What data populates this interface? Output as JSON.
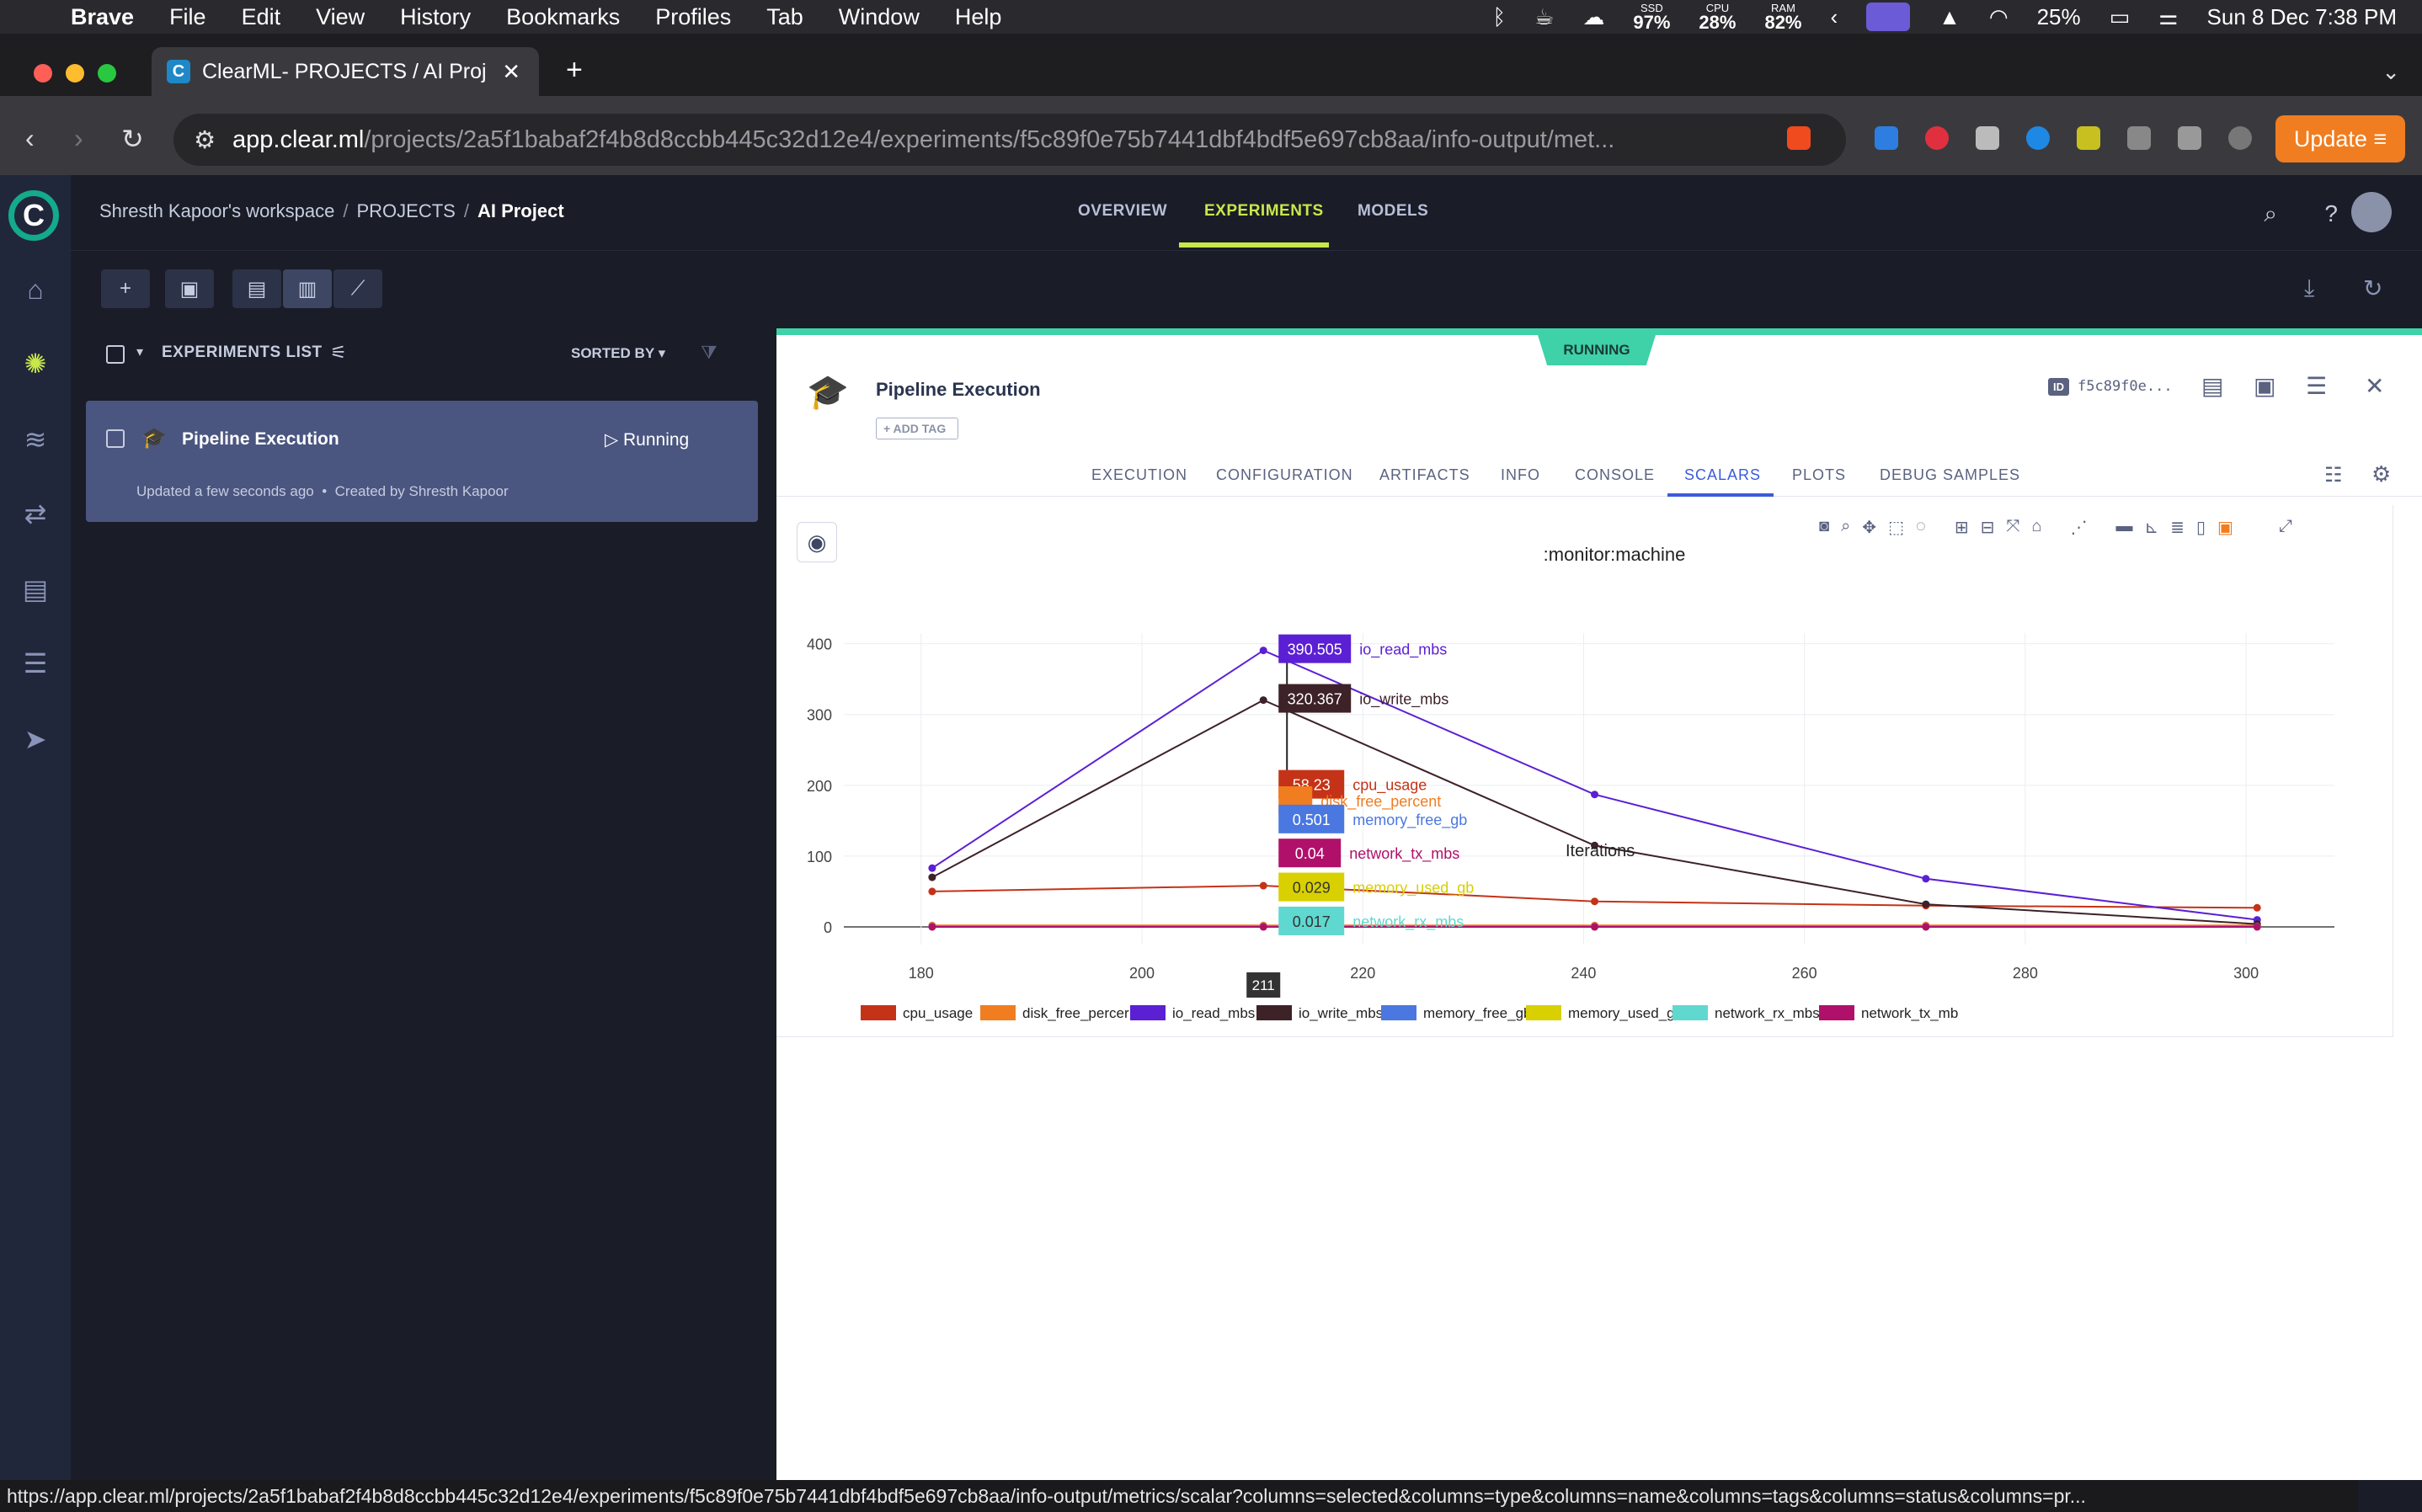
{
  "menubar": {
    "app": "Brave",
    "items": [
      "File",
      "Edit",
      "View",
      "History",
      "Bookmarks",
      "Profiles",
      "Tab",
      "Window",
      "Help"
    ],
    "ssd_label": "SSD",
    "ssd_value": "97%",
    "cpu_label": "CPU",
    "cpu_value": "28%",
    "ram_label": "RAM",
    "ram_value": "82%",
    "battery": "25%",
    "datetime": "Sun 8 Dec  7:38 PM"
  },
  "browser": {
    "tab_title": "ClearML- PROJECTS / AI Proj",
    "tab_favicon": "C",
    "url_host": "app.clear.ml",
    "url_path": "/projects/2a5f1babaf2f4b8d8ccbb445c32d12e4/experiments/f5c89f0e75b7441dbf4bdf5e697cb8aa/info-output/met...",
    "update_label": "Update",
    "status_url": "https://app.clear.ml/projects/2a5f1babaf2f4b8d8ccbb445c32d12e4/experiments/f5c89f0e75b7441dbf4bdf5e697cb8aa/info-output/metrics/scalar?columns=selected&columns=type&columns=name&columns=tags&columns=status&columns=pr..."
  },
  "app": {
    "logo_letter": "C",
    "breadcrumb": {
      "workspace": "Shresth Kapoor's workspace",
      "section": "PROJECTS",
      "project": "AI Project"
    },
    "topnav": [
      "OVERVIEW",
      "EXPERIMENTS",
      "MODELS"
    ],
    "list": {
      "title": "EXPERIMENTS LIST",
      "sorted_by": "SORTED BY",
      "rows": [
        {
          "name": "Pipeline Execution",
          "status": "Running",
          "updated": "Updated a few seconds ago",
          "created": "Created by Shresth Kapoor"
        }
      ]
    },
    "panel": {
      "status_badge": "RUNNING",
      "title": "Pipeline Execution",
      "add_tag": "+ ADD TAG",
      "id_label": "ID",
      "id_value": "f5c89f0e...",
      "tabs": [
        "EXECUTION",
        "CONFIGURATION",
        "ARTIFACTS",
        "INFO",
        "CONSOLE",
        "SCALARS",
        "PLOTS",
        "DEBUG SAMPLES"
      ],
      "active_tab": "SCALARS"
    }
  },
  "chart_data": {
    "type": "line",
    "title": ":monitor:machine",
    "xlabel": "Iterations",
    "xlim": [
      173,
      308
    ],
    "ylim": [
      -25,
      415
    ],
    "xticks": [
      180,
      200,
      220,
      240,
      260,
      280,
      300
    ],
    "yticks": [
      0,
      100,
      200,
      300,
      400
    ],
    "x": [
      181,
      211,
      241,
      271,
      301
    ],
    "hover_x": "211",
    "series": [
      {
        "name": "cpu_usage",
        "color": "#c43318",
        "values": [
          50,
          58.23,
          36,
          30,
          27
        ]
      },
      {
        "name": "disk_free_percent",
        "color": "#f07d1f",
        "values": [
          2,
          2,
          2,
          2,
          2
        ]
      },
      {
        "name": "io_read_mbs",
        "color": "#5b1fd4",
        "values": [
          83,
          390.505,
          187,
          68,
          10
        ]
      },
      {
        "name": "io_write_mbs",
        "color": "#3d2228",
        "values": [
          70,
          320.367,
          115,
          32,
          4
        ]
      },
      {
        "name": "memory_free_gb",
        "color": "#4a78e0",
        "values": [
          0.5,
          0.501,
          0.5,
          0.5,
          0.5
        ]
      },
      {
        "name": "memory_used_gb",
        "color": "#d8d000",
        "values": [
          0.03,
          0.029,
          0.03,
          0.03,
          0.03
        ]
      },
      {
        "name": "network_rx_mbs",
        "color": "#5fd8d0",
        "values": [
          0.02,
          0.017,
          0.02,
          0.02,
          0.02
        ]
      },
      {
        "name": "network_tx_mbs",
        "color": "#b0106a",
        "values": [
          0.04,
          0.04,
          0.04,
          0.04,
          0.04
        ]
      }
    ],
    "hover": [
      {
        "series": "io_read_mbs",
        "label": "390.505"
      },
      {
        "series": "io_write_mbs",
        "label": "320.367"
      },
      {
        "series": "cpu_usage",
        "label": "58.23"
      },
      {
        "series": "disk_free_percent",
        "label": ""
      },
      {
        "series": "memory_free_gb",
        "label": "0.501"
      },
      {
        "series": "network_tx_mbs",
        "label": "0.04"
      },
      {
        "series": "memory_used_gb",
        "label": "0.029"
      },
      {
        "series": "network_rx_mbs",
        "label": "0.017"
      }
    ],
    "legend": [
      "cpu_usage",
      "disk_free_percer",
      "io_read_mbs",
      "io_write_mbs",
      "memory_free_gb",
      "memory_used_gb",
      "network_rx_mbs",
      "network_tx_mb"
    ]
  }
}
